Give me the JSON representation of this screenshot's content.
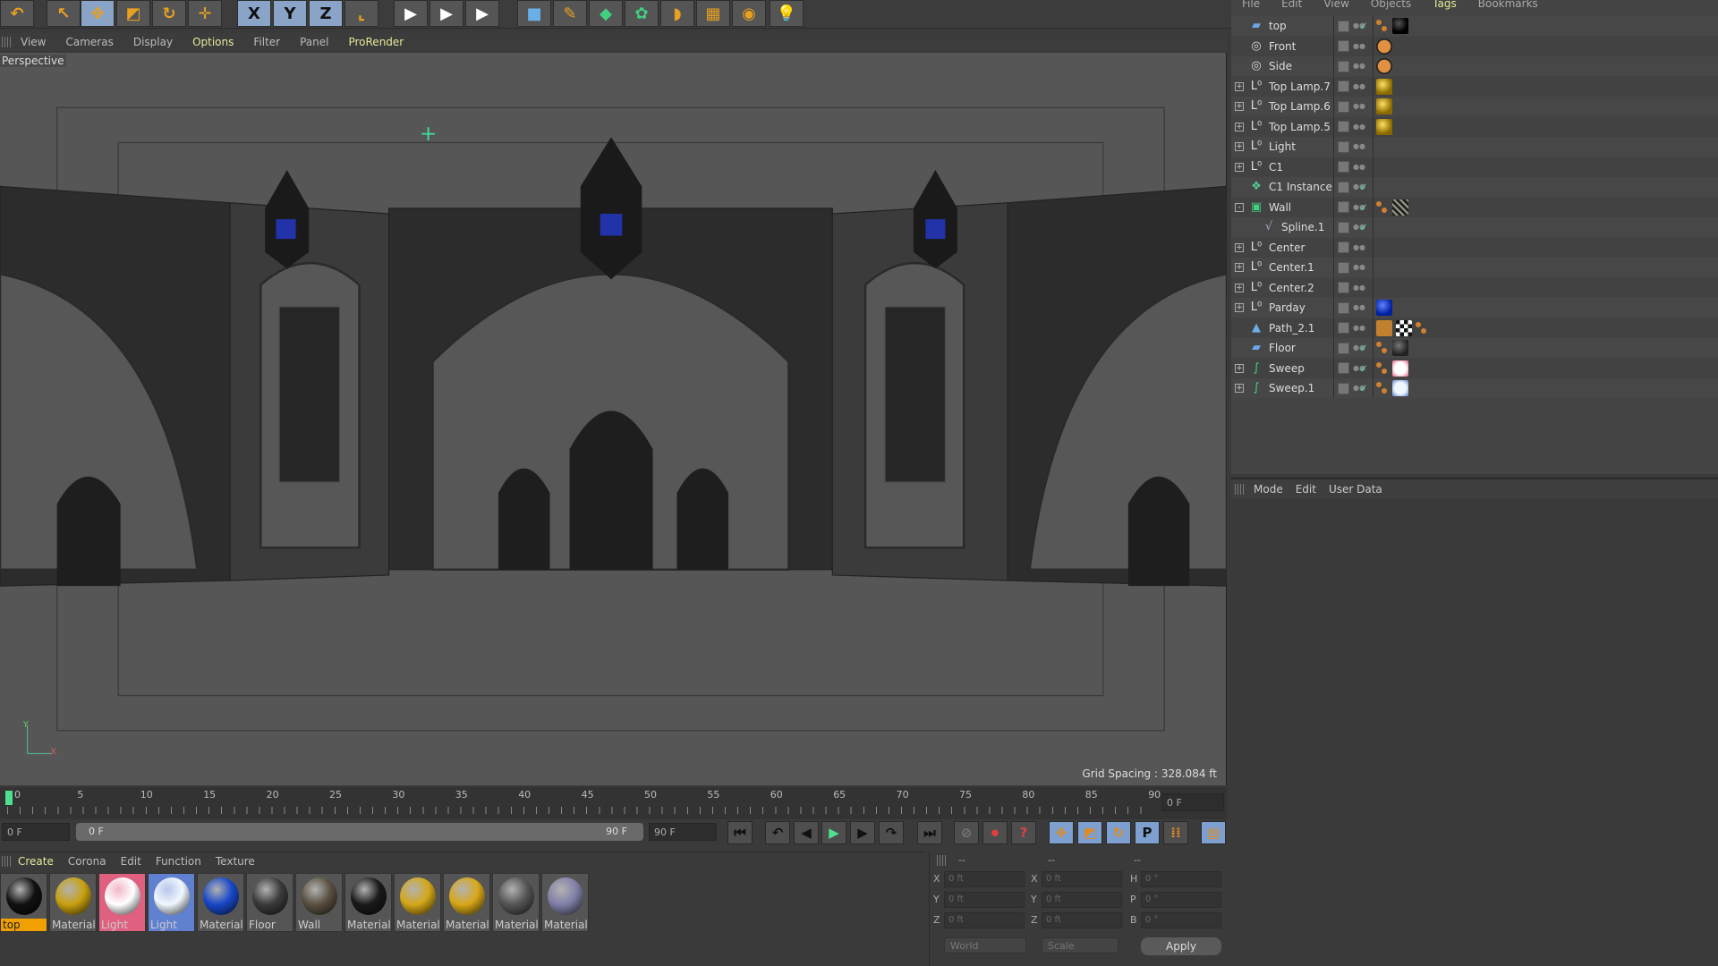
{
  "toolbar": {
    "icons": [
      "undo-icon",
      "select-icon",
      "move-icon",
      "scale-icon",
      "rotate-icon",
      "transform-icon",
      "x-axis-icon",
      "y-axis-icon",
      "z-axis-icon",
      "coord-system-icon",
      "render-view-icon",
      "render-picture-viewer-icon",
      "render-settings-icon",
      "cube-icon",
      "pen-icon",
      "subdivision-icon",
      "cloner-icon",
      "deformer-icon",
      "floor-icon",
      "camera-icon",
      "light-icon"
    ],
    "x": "X",
    "y": "Y",
    "z": "Z"
  },
  "viewport": {
    "menu": [
      "View",
      "Cameras",
      "Display",
      "Options",
      "Filter",
      "Panel",
      "ProRender"
    ],
    "label": "Perspective",
    "grid_spacing": "Grid Spacing : 328.084 ft",
    "axis_y": "Y",
    "axis_x": "X"
  },
  "object_manager": {
    "menu": [
      "File",
      "Edit",
      "View",
      "Objects",
      "Tags",
      "Bookmarks"
    ],
    "objects": [
      {
        "name": "top",
        "type": "plane",
        "check": true,
        "tags": [
          "material",
          "black"
        ]
      },
      {
        "name": "Front",
        "type": "camera",
        "tags": [
          "protect"
        ]
      },
      {
        "name": "Side",
        "type": "camera",
        "tags": [
          "protect"
        ]
      },
      {
        "name": "Top Lamp.7",
        "type": "null",
        "expand": "+",
        "tags": [
          "gold"
        ]
      },
      {
        "name": "Top Lamp.6",
        "type": "null",
        "expand": "+",
        "tags": [
          "gold"
        ]
      },
      {
        "name": "Top Lamp.5",
        "type": "null",
        "expand": "+",
        "tags": [
          "gold"
        ]
      },
      {
        "name": "Light",
        "type": "null",
        "expand": "+",
        "tags": []
      },
      {
        "name": "C1",
        "type": "null",
        "expand": "+",
        "tags": []
      },
      {
        "name": "C1 Instance",
        "type": "instance",
        "check": true,
        "tags": []
      },
      {
        "name": "Wall",
        "type": "extrude",
        "expand": "-",
        "check": true,
        "tags": [
          "material",
          "wall"
        ]
      },
      {
        "name": "Spline.1",
        "type": "spline",
        "check": true,
        "indent": true,
        "tags": []
      },
      {
        "name": "Center",
        "type": "null",
        "expand": "+",
        "tags": []
      },
      {
        "name": "Center.1",
        "type": "null",
        "expand": "+",
        "tags": []
      },
      {
        "name": "Center.2",
        "type": "null",
        "expand": "+",
        "tags": []
      },
      {
        "name": "Parday",
        "type": "null",
        "expand": "+",
        "tags": [
          "blue"
        ]
      },
      {
        "name": "Path_2.1",
        "type": "path",
        "tags": [
          "phong",
          "checker",
          "material"
        ]
      },
      {
        "name": "Floor",
        "type": "plane",
        "check": true,
        "tags": [
          "material",
          "dark"
        ]
      },
      {
        "name": "Sweep",
        "type": "sweep",
        "expand": "+",
        "check": true,
        "tags": [
          "material",
          "pink"
        ]
      },
      {
        "name": "Sweep.1",
        "type": "sweep",
        "expand": "+",
        "check": true,
        "tags": [
          "material",
          "lightblue"
        ]
      }
    ]
  },
  "attribute_manager": {
    "menu": [
      "Mode",
      "Edit",
      "User Data"
    ]
  },
  "timeline": {
    "ticks": [
      "0",
      "5",
      "10",
      "15",
      "20",
      "25",
      "30",
      "35",
      "40",
      "45",
      "50",
      "55",
      "60",
      "65",
      "70",
      "75",
      "80",
      "85",
      "90"
    ],
    "current_frame": "0 F",
    "start": "0 F",
    "range_start": "0 F",
    "range_end": "90 F",
    "end": "90 F"
  },
  "materials": {
    "menu": [
      "Create",
      "Corona",
      "Edit",
      "Function",
      "Texture"
    ],
    "items": [
      {
        "label": "top",
        "color": "#111111",
        "selected": true
      },
      {
        "label": "Material",
        "color": "#c8a010"
      },
      {
        "label": "Light",
        "color": "#ffffff",
        "bg": "#e06080"
      },
      {
        "label": "Light",
        "color": "#f0f8ff",
        "bg": "#6080d0"
      },
      {
        "label": "Material",
        "color": "#1848c8"
      },
      {
        "label": "Floor",
        "color": "#3a3a3a"
      },
      {
        "label": "Wall",
        "color": "#5a5040"
      },
      {
        "label": "Material",
        "color": "#1a1a1a"
      },
      {
        "label": "Material",
        "color": "#d4a818"
      },
      {
        "label": "Material",
        "color": "#d8a818"
      },
      {
        "label": "Material",
        "color": "#555555"
      },
      {
        "label": "Material",
        "color": "#8080a8"
      }
    ]
  },
  "coordinates": {
    "headers": [
      "--",
      "--",
      "--"
    ],
    "rows": [
      {
        "a": "X",
        "av": "0 ft",
        "b": "X",
        "bv": "0 ft",
        "c": "H",
        "cv": "0 °"
      },
      {
        "a": "Y",
        "av": "0 ft",
        "b": "Y",
        "bv": "0 ft",
        "c": "P",
        "cv": "0 °"
      },
      {
        "a": "Z",
        "av": "0 ft",
        "b": "Z",
        "bv": "0 ft",
        "c": "B",
        "cv": "0 °"
      }
    ],
    "mode": "World",
    "scale": "Scale",
    "apply": "Apply"
  }
}
